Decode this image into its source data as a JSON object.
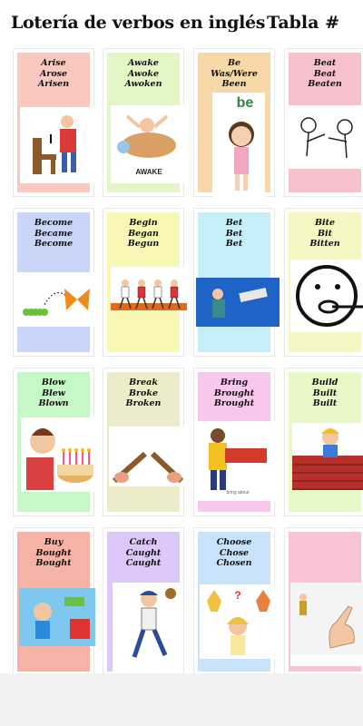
{
  "header": {
    "title": "Lotería de verbos en inglés",
    "tabla_label": "Tabla #"
  },
  "cards": [
    {
      "lines": [
        "Arise",
        "Arose",
        "Arisen"
      ],
      "color": "#f9c9bf",
      "picture": "person-rising-from-chair"
    },
    {
      "lines": [
        "Awake",
        "Awoke",
        "Awoken"
      ],
      "color": "#e3f7c6",
      "picture": "child-waking-up",
      "picture_caption": "AWAKE"
    },
    {
      "lines": [
        "Be",
        "Was/Were",
        "Been"
      ],
      "color": "#f7d8a8",
      "picture": "girl-with-be-label",
      "picture_caption": "be"
    },
    {
      "lines": [
        "Beat",
        "Beat",
        "Beaten"
      ],
      "color": "#f7c1cc",
      "picture": "two-people-fighting"
    },
    {
      "lines": [
        "Become",
        "Became",
        "Become"
      ],
      "color": "#c9d5f9",
      "picture": "caterpillar-to-butterfly"
    },
    {
      "lines": [
        "Begin",
        "Began",
        "Begun"
      ],
      "color": "#f8f7b6",
      "picture": "runners-starting-race"
    },
    {
      "lines": [
        "Bet",
        "Bet",
        "Bet"
      ],
      "color": "#c6eef9",
      "picture": "hand-with-money"
    },
    {
      "lines": [
        "Bite",
        "Bit",
        "Bitten"
      ],
      "color": "#f6f6c2",
      "picture": "face-biting"
    },
    {
      "lines": [
        "Blow",
        "Blew",
        "Blown"
      ],
      "color": "#c6f7c6",
      "picture": "boy-blowing-candles"
    },
    {
      "lines": [
        "Break",
        "Broke",
        "Broken"
      ],
      "color": "#ececc8",
      "picture": "breaking-stick"
    },
    {
      "lines": [
        "Bring",
        "Brought",
        "Brought"
      ],
      "color": "#f8c8ec",
      "picture": "man-carrying-box",
      "picture_caption": "bring about"
    },
    {
      "lines": [
        "Build",
        "Built",
        "Built"
      ],
      "color": "#e6f9c6",
      "picture": "worker-building-wall"
    },
    {
      "lines": [
        "Buy",
        "Bought",
        "Bought"
      ],
      "color": "#f6b2a4",
      "picture": "boy-buying"
    },
    {
      "lines": [
        "Catch",
        "Caught",
        "Caught"
      ],
      "color": "#dcc8f8",
      "picture": "player-catching-ball"
    },
    {
      "lines": [
        "Choose",
        "Chose",
        "Chosen"
      ],
      "color": "#c8e2f9",
      "picture": "girl-choosing-dresses"
    },
    {
      "lines": [
        "",
        "",
        ""
      ],
      "color": "#f9c4d8",
      "picture": "hand-pointing-at-man"
    }
  ]
}
